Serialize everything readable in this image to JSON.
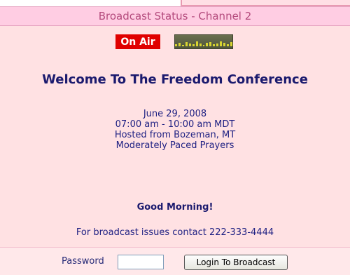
{
  "header": {
    "title": "Broadcast Status - Channel 2"
  },
  "status": {
    "on_air_label": "On Air",
    "level_meter": "audio-level-meter-icon"
  },
  "main": {
    "welcome": "Welcome To The Freedom Conference",
    "date": "June 29, 2008",
    "time": "07:00 am - 10:00 am MDT",
    "location": "Hosted from Bozeman, MT",
    "description": "Moderately Paced Prayers",
    "greeting": "Good Morning!",
    "contact": "For broadcast issues contact 222-333-4444"
  },
  "login": {
    "password_label": "Password",
    "password_value": "",
    "button_label": "Login To Broadcast"
  },
  "colors": {
    "header_bg": "#ffcde3",
    "panel_bg": "#ffe1e3",
    "on_air": "#e00000",
    "title_text": "#1b1a6e"
  }
}
